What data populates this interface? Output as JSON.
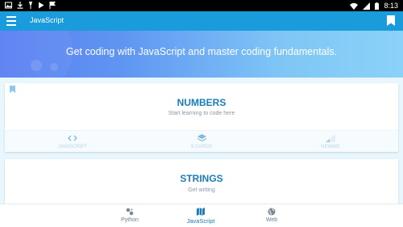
{
  "status_bar": {
    "time": "8:13"
  },
  "app_bar": {
    "title": "JavaScript"
  },
  "hero": {
    "tagline": "Get coding with JavaScript and master coding fundamentals."
  },
  "cards": [
    {
      "title": "NUMBERS",
      "subtitle": "Start learning to code here",
      "stats": [
        {
          "icon": "code-icon",
          "label": "JAVASCRIPT"
        },
        {
          "icon": "layers-icon",
          "label": "9 CARDS"
        },
        {
          "icon": "signal-bars-icon",
          "label": "NEWBIE"
        }
      ]
    },
    {
      "title": "STRINGS",
      "subtitle": "Get writing"
    }
  ],
  "bottom_nav": [
    {
      "label": "Python",
      "icon": "python-icon",
      "active": false
    },
    {
      "label": "JavaScript",
      "icon": "map-icon",
      "active": true
    },
    {
      "label": "Web",
      "icon": "globe-icon",
      "active": false
    }
  ],
  "colors": {
    "app_bar": "#1a9bdc",
    "accent": "#1a7cb8",
    "hero_start": "#5a7ef2",
    "hero_end": "#8bd2f8"
  }
}
